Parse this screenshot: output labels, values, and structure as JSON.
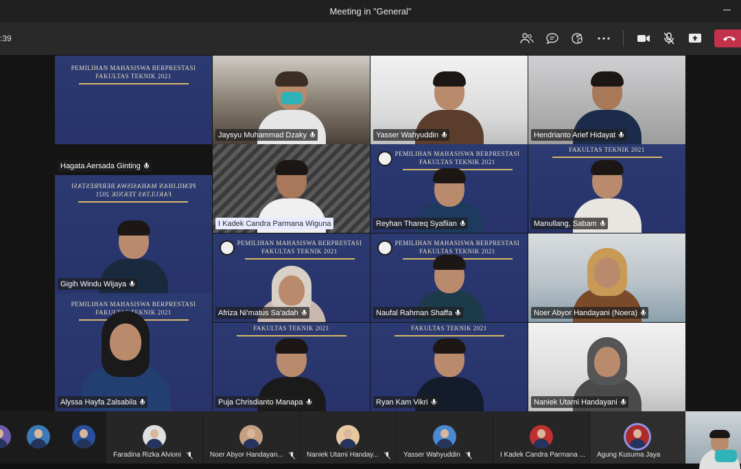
{
  "window": {
    "title": "Meeting in \"General\""
  },
  "toolbar": {
    "timer": ":39",
    "icons": [
      "participants-icon",
      "chat-icon",
      "reactions-icon",
      "more-icon",
      "camera-icon",
      "mic-muted-icon",
      "share-icon",
      "hang-up-icon"
    ]
  },
  "banners": {
    "line1": "PEMILIHAN MAHASISWA BERPRESTASI",
    "line2": "FAKULTAS TEKNIK 2021",
    "short": "FAKULTAS TEKNIK 2021",
    "partial": "PEMILIHAN MAHASISWA BERPRESTASI"
  },
  "colors": {
    "accent": "#8d96e8",
    "hangup": "#c4314b",
    "banner_bg": "#2c3a72",
    "banner_gold": "#d9b86a"
  },
  "participants": [
    {
      "name": "Hagata Aersada Ginting"
    },
    {
      "name": "Jaysyu Muhammad Dzaky"
    },
    {
      "name": "Yasser Wahyuddin"
    },
    {
      "name": "Hendrianto Arief Hidayat"
    },
    {
      "name": "I Kadek Candra Parmana Wiguna"
    },
    {
      "name": "Reyhan Thareq Syaflian"
    },
    {
      "name": "Manullang, Sabam"
    },
    {
      "name": "Gigih Windu Wijaya"
    },
    {
      "name": "Afriza Ni'matus Sa'adah"
    },
    {
      "name": "Naufal Rahman Shaffa"
    },
    {
      "name": "Noer Abyor Handayani (Noera)"
    },
    {
      "name": "Alyssa Hayfa Zalsabila"
    },
    {
      "name": "Puja Chrisdianto Manapa"
    },
    {
      "name": "Ryan Kam Vikri"
    },
    {
      "name": "Naniek Utami Handayani"
    }
  ],
  "gallery": [
    {
      "name": "Faradina Rizka Alvioni"
    },
    {
      "name": "Noer Abyor Handayan..."
    },
    {
      "name": "Naniek Utami Handay..."
    },
    {
      "name": "Yasser Wahyuddin"
    },
    {
      "name": "I Kadek Candra Parmana ..."
    },
    {
      "name": "Agung Kusuma Jaya"
    }
  ]
}
